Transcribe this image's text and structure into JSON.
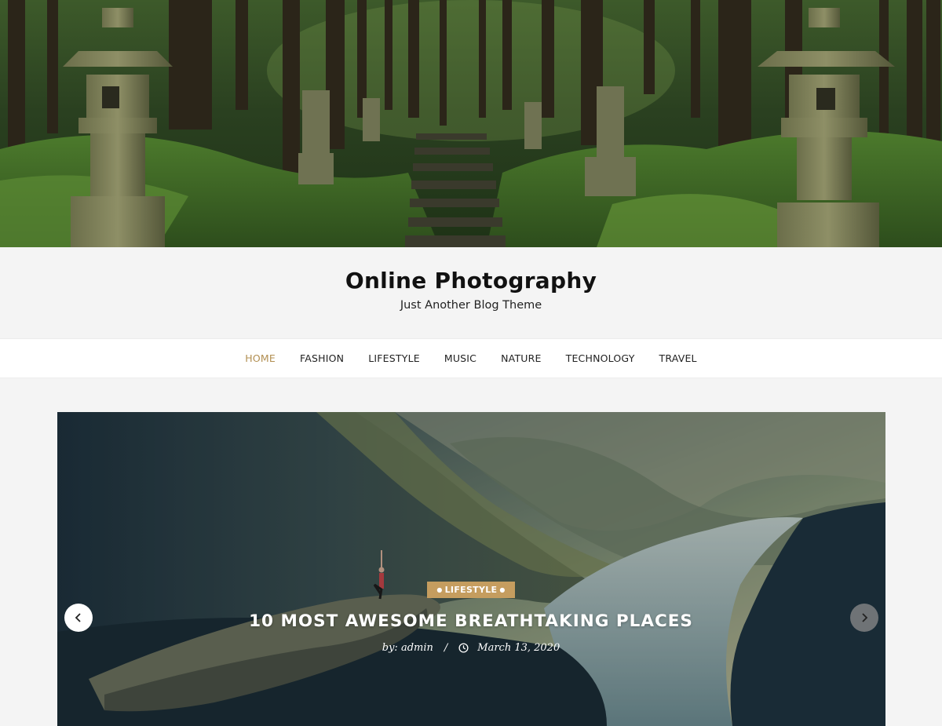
{
  "site": {
    "title": "Online Photography",
    "tagline": "Just Another Blog Theme"
  },
  "nav": {
    "items": [
      {
        "label": "HOME",
        "active": true
      },
      {
        "label": "FASHION",
        "active": false
      },
      {
        "label": "LIFESTYLE",
        "active": false
      },
      {
        "label": "MUSIC",
        "active": false
      },
      {
        "label": "NATURE",
        "active": false
      },
      {
        "label": "TECHNOLOGY",
        "active": false
      },
      {
        "label": "TRAVEL",
        "active": false
      }
    ]
  },
  "slider": {
    "category": "LIFESTYLE",
    "title": "10 MOST AWESOME BREATHTAKING PLACES",
    "author": "by: admin",
    "separator": "/",
    "date": "March 13, 2020",
    "prev_icon": "chevron-left-icon",
    "next_icon": "chevron-right-icon"
  },
  "colors": {
    "accent": "#b28f52",
    "badge": "#c59d5f",
    "background": "#f4f4f4",
    "nav_background": "#ffffff"
  }
}
